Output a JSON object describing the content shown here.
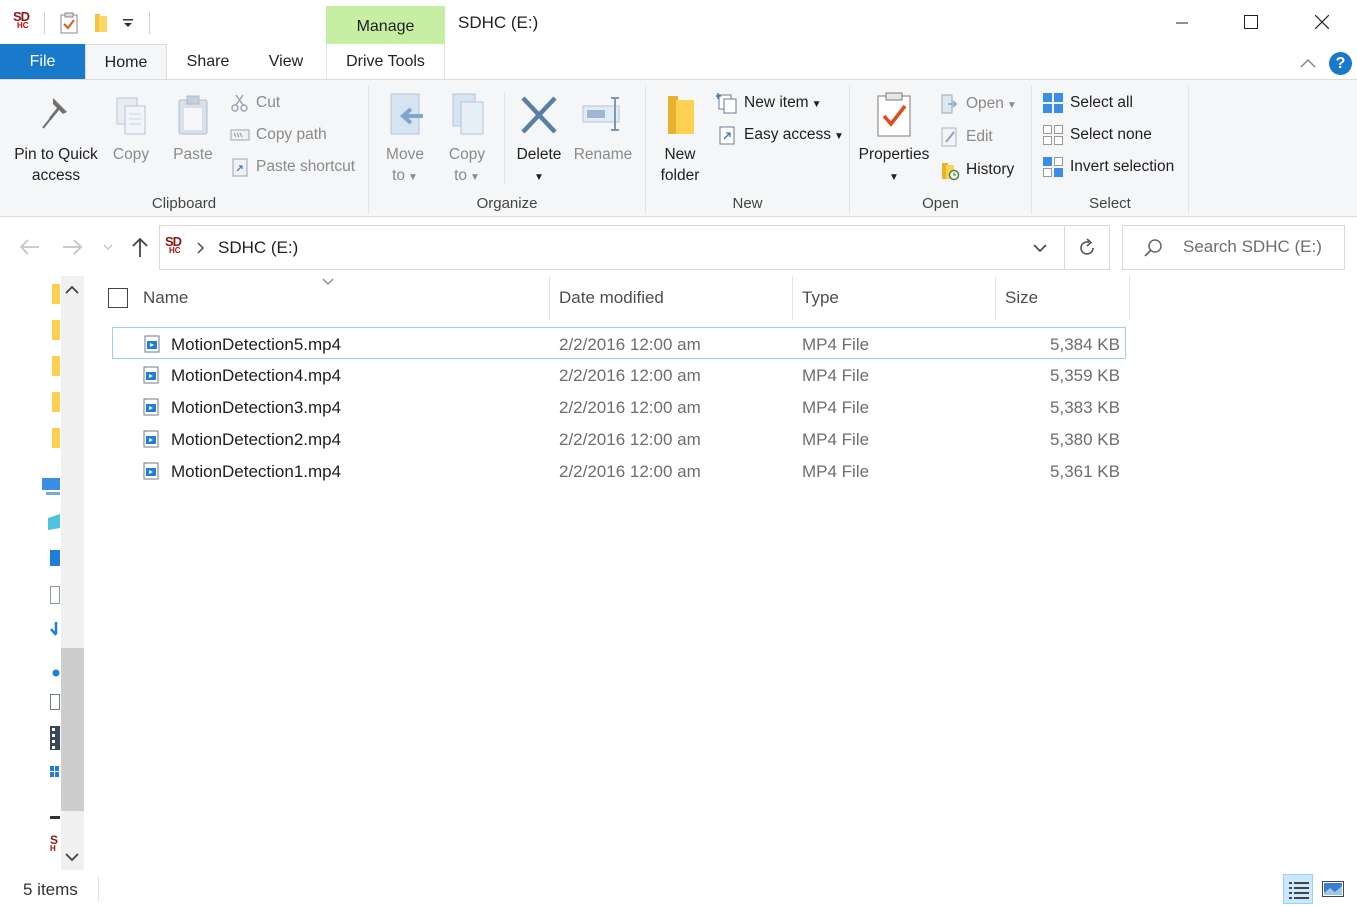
{
  "window": {
    "title": "SDHC (E:)",
    "drive_logo_text": "SD",
    "drive_logo_sub": "HC"
  },
  "contextual_tab": {
    "label": "Manage"
  },
  "tabs": [
    {
      "label": "File"
    },
    {
      "label": "Home"
    },
    {
      "label": "Share"
    },
    {
      "label": "View"
    },
    {
      "label": "Drive Tools"
    }
  ],
  "ribbon": {
    "clipboard": {
      "label": "Clipboard",
      "pin_line1": "Pin to Quick",
      "pin_line2": "access",
      "copy": "Copy",
      "paste": "Paste",
      "cut": "Cut",
      "copy_path": "Copy path",
      "paste_shortcut": "Paste shortcut"
    },
    "organize": {
      "label": "Organize",
      "move_line1": "Move",
      "move_line2": "to",
      "copy_line1": "Copy",
      "copy_line2": "to",
      "delete": "Delete",
      "rename": "Rename"
    },
    "new": {
      "label": "New",
      "folder_line1": "New",
      "folder_line2": "folder",
      "new_item": "New item",
      "easy_access": "Easy access"
    },
    "open": {
      "label": "Open",
      "properties": "Properties",
      "open": "Open",
      "edit": "Edit",
      "history": "History"
    },
    "select": {
      "label": "Select",
      "select_all": "Select all",
      "select_none": "Select none",
      "invert": "Invert selection"
    }
  },
  "address": {
    "path": "SDHC (E:)",
    "search_placeholder": "Search SDHC (E:)"
  },
  "columns": {
    "name": "Name",
    "date": "Date modified",
    "type": "Type",
    "size": "Size"
  },
  "files": [
    {
      "name": "MotionDetection5.mp4",
      "date": "2/2/2016 12:00 am",
      "type": "MP4 File",
      "size": "5,384 KB"
    },
    {
      "name": "MotionDetection4.mp4",
      "date": "2/2/2016 12:00 am",
      "type": "MP4 File",
      "size": "5,359 KB"
    },
    {
      "name": "MotionDetection3.mp4",
      "date": "2/2/2016 12:00 am",
      "type": "MP4 File",
      "size": "5,383 KB"
    },
    {
      "name": "MotionDetection2.mp4",
      "date": "2/2/2016 12:00 am",
      "type": "MP4 File",
      "size": "5,380 KB"
    },
    {
      "name": "MotionDetection1.mp4",
      "date": "2/2/2016 12:00 am",
      "type": "MP4 File",
      "size": "5,361 KB"
    }
  ],
  "status": {
    "item_count": "5 items"
  },
  "colors": {
    "file_tab": "#1979ca",
    "manage_tab": "#c7efa3",
    "selection_border": "#99d1ff"
  }
}
